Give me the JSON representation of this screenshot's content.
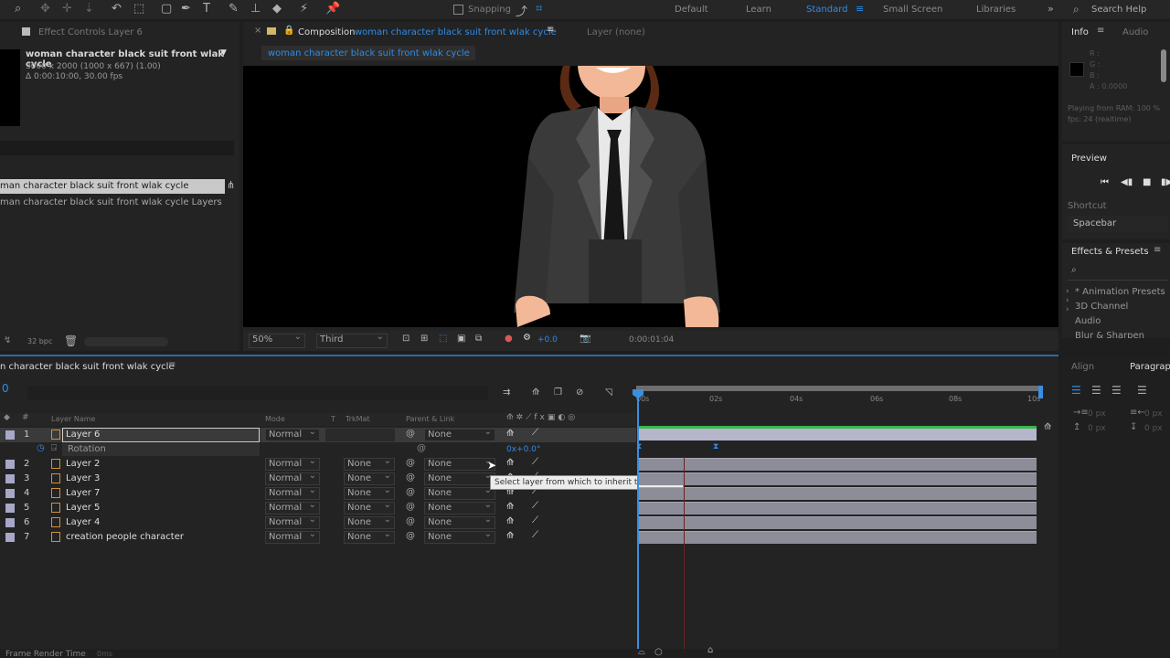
{
  "toolbar": {
    "snapping_label": "Snapping",
    "workspaces": [
      "Default",
      "Learn",
      "Standard",
      "Small Screen",
      "Libraries"
    ],
    "active_workspace": "Standard",
    "search_help": "Search Help"
  },
  "effect_controls": {
    "title": "Effect Controls Layer 6",
    "comp_name": "woman character black suit front wlak cycle",
    "comp_size": "3000 x 2000  (1000 x 667) (1.00)",
    "comp_duration": "Δ 0:00:10:00, 30.00 fps",
    "project_item": "man character black suit front wlak cycle",
    "project_item_layers": "man character black suit front wlak cycle Layers",
    "bpc": "32 bpc"
  },
  "composition": {
    "tab_prefix": "Composition",
    "tab_name": "woman character black suit front wlak cycle",
    "layer_tab": "Layer  (none)",
    "breadcrumb": "woman character black suit front wlak cycle",
    "zoom": "50%",
    "resolution": "Third",
    "exposure": "+0.0",
    "timecode": "0:00:01:04"
  },
  "info_panel": {
    "tab_info": "Info",
    "tab_audio": "Audio",
    "r": "R :",
    "g": "G :",
    "b": "B :",
    "a": "A :  0.0000",
    "playing": "Playing from RAM: 100 %",
    "fps": "fps: 24 (realtime)"
  },
  "preview_panel": {
    "title": "Preview",
    "shortcut_label": "Shortcut",
    "shortcut_value": "Spacebar"
  },
  "effects_presets": {
    "title": "Effects & Presets",
    "items": [
      "* Animation Presets",
      "3D Channel",
      "Audio",
      "Blur & Sharpen"
    ]
  },
  "right_bottom": {
    "align": "Align",
    "paragraph": "Paragraph",
    "px1": "0 px",
    "px2": "0 px",
    "px3": "0 px",
    "px4": "0 px"
  },
  "timeline": {
    "comp_tab": "n character black suit front wlak cycle",
    "current_time": "0",
    "col_layer_name": "Layer Name",
    "col_mode": "Mode",
    "col_t": "T",
    "col_trkmat": "TrkMat",
    "col_parent": "Parent & Link",
    "ruler": [
      "00s",
      "02s",
      "04s",
      "06s",
      "08s",
      "10s"
    ],
    "rotation_label": "Rotation",
    "rotation_value": "0x+0.0°",
    "tooltip": "Select layer from which to inherit transforms",
    "footer": "Frame Render Time",
    "footer_value": "0ms",
    "layers": [
      {
        "num": "1",
        "name": "Layer 6",
        "mode": "Normal",
        "trkmat": "",
        "parent": "None"
      },
      {
        "num": "2",
        "name": "Layer 2",
        "mode": "Normal",
        "trkmat": "None",
        "parent": "None"
      },
      {
        "num": "3",
        "name": "Layer 3",
        "mode": "Normal",
        "trkmat": "None",
        "parent": "None"
      },
      {
        "num": "4",
        "name": "Layer 7",
        "mode": "Normal",
        "trkmat": "None",
        "parent": "None"
      },
      {
        "num": "5",
        "name": "Layer 5",
        "mode": "Normal",
        "trkmat": "None",
        "parent": "None"
      },
      {
        "num": "6",
        "name": "Layer 4",
        "mode": "Normal",
        "trkmat": "None",
        "parent": "None"
      },
      {
        "num": "7",
        "name": "creation people character",
        "mode": "Normal",
        "trkmat": "None",
        "parent": "None"
      }
    ]
  },
  "colors": {
    "accent": "#2d8ceb",
    "layer_bar": "#8d8d99",
    "playhead": "#3a8fe0",
    "label_chip": "#a7a7c8",
    "background": "#232323"
  }
}
